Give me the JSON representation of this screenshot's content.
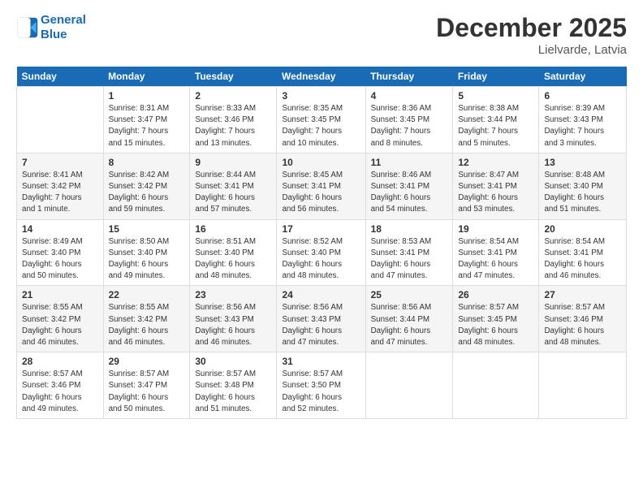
{
  "logo": {
    "line1": "General",
    "line2": "Blue"
  },
  "title": "December 2025",
  "location": "Lielvarde, Latvia",
  "weekdays": [
    "Sunday",
    "Monday",
    "Tuesday",
    "Wednesday",
    "Thursday",
    "Friday",
    "Saturday"
  ],
  "weeks": [
    [
      {
        "day": "",
        "text": ""
      },
      {
        "day": "1",
        "text": "Sunrise: 8:31 AM\nSunset: 3:47 PM\nDaylight: 7 hours\nand 15 minutes."
      },
      {
        "day": "2",
        "text": "Sunrise: 8:33 AM\nSunset: 3:46 PM\nDaylight: 7 hours\nand 13 minutes."
      },
      {
        "day": "3",
        "text": "Sunrise: 8:35 AM\nSunset: 3:45 PM\nDaylight: 7 hours\nand 10 minutes."
      },
      {
        "day": "4",
        "text": "Sunrise: 8:36 AM\nSunset: 3:45 PM\nDaylight: 7 hours\nand 8 minutes."
      },
      {
        "day": "5",
        "text": "Sunrise: 8:38 AM\nSunset: 3:44 PM\nDaylight: 7 hours\nand 5 minutes."
      },
      {
        "day": "6",
        "text": "Sunrise: 8:39 AM\nSunset: 3:43 PM\nDaylight: 7 hours\nand 3 minutes."
      }
    ],
    [
      {
        "day": "7",
        "text": "Sunrise: 8:41 AM\nSunset: 3:42 PM\nDaylight: 7 hours\nand 1 minute."
      },
      {
        "day": "8",
        "text": "Sunrise: 8:42 AM\nSunset: 3:42 PM\nDaylight: 6 hours\nand 59 minutes."
      },
      {
        "day": "9",
        "text": "Sunrise: 8:44 AM\nSunset: 3:41 PM\nDaylight: 6 hours\nand 57 minutes."
      },
      {
        "day": "10",
        "text": "Sunrise: 8:45 AM\nSunset: 3:41 PM\nDaylight: 6 hours\nand 56 minutes."
      },
      {
        "day": "11",
        "text": "Sunrise: 8:46 AM\nSunset: 3:41 PM\nDaylight: 6 hours\nand 54 minutes."
      },
      {
        "day": "12",
        "text": "Sunrise: 8:47 AM\nSunset: 3:41 PM\nDaylight: 6 hours\nand 53 minutes."
      },
      {
        "day": "13",
        "text": "Sunrise: 8:48 AM\nSunset: 3:40 PM\nDaylight: 6 hours\nand 51 minutes."
      }
    ],
    [
      {
        "day": "14",
        "text": "Sunrise: 8:49 AM\nSunset: 3:40 PM\nDaylight: 6 hours\nand 50 minutes."
      },
      {
        "day": "15",
        "text": "Sunrise: 8:50 AM\nSunset: 3:40 PM\nDaylight: 6 hours\nand 49 minutes."
      },
      {
        "day": "16",
        "text": "Sunrise: 8:51 AM\nSunset: 3:40 PM\nDaylight: 6 hours\nand 48 minutes."
      },
      {
        "day": "17",
        "text": "Sunrise: 8:52 AM\nSunset: 3:40 PM\nDaylight: 6 hours\nand 48 minutes."
      },
      {
        "day": "18",
        "text": "Sunrise: 8:53 AM\nSunset: 3:41 PM\nDaylight: 6 hours\nand 47 minutes."
      },
      {
        "day": "19",
        "text": "Sunrise: 8:54 AM\nSunset: 3:41 PM\nDaylight: 6 hours\nand 47 minutes."
      },
      {
        "day": "20",
        "text": "Sunrise: 8:54 AM\nSunset: 3:41 PM\nDaylight: 6 hours\nand 46 minutes."
      }
    ],
    [
      {
        "day": "21",
        "text": "Sunrise: 8:55 AM\nSunset: 3:42 PM\nDaylight: 6 hours\nand 46 minutes."
      },
      {
        "day": "22",
        "text": "Sunrise: 8:55 AM\nSunset: 3:42 PM\nDaylight: 6 hours\nand 46 minutes."
      },
      {
        "day": "23",
        "text": "Sunrise: 8:56 AM\nSunset: 3:43 PM\nDaylight: 6 hours\nand 46 minutes."
      },
      {
        "day": "24",
        "text": "Sunrise: 8:56 AM\nSunset: 3:43 PM\nDaylight: 6 hours\nand 47 minutes."
      },
      {
        "day": "25",
        "text": "Sunrise: 8:56 AM\nSunset: 3:44 PM\nDaylight: 6 hours\nand 47 minutes."
      },
      {
        "day": "26",
        "text": "Sunrise: 8:57 AM\nSunset: 3:45 PM\nDaylight: 6 hours\nand 48 minutes."
      },
      {
        "day": "27",
        "text": "Sunrise: 8:57 AM\nSunset: 3:46 PM\nDaylight: 6 hours\nand 48 minutes."
      }
    ],
    [
      {
        "day": "28",
        "text": "Sunrise: 8:57 AM\nSunset: 3:46 PM\nDaylight: 6 hours\nand 49 minutes."
      },
      {
        "day": "29",
        "text": "Sunrise: 8:57 AM\nSunset: 3:47 PM\nDaylight: 6 hours\nand 50 minutes."
      },
      {
        "day": "30",
        "text": "Sunrise: 8:57 AM\nSunset: 3:48 PM\nDaylight: 6 hours\nand 51 minutes."
      },
      {
        "day": "31",
        "text": "Sunrise: 8:57 AM\nSunset: 3:50 PM\nDaylight: 6 hours\nand 52 minutes."
      },
      {
        "day": "",
        "text": ""
      },
      {
        "day": "",
        "text": ""
      },
      {
        "day": "",
        "text": ""
      }
    ]
  ]
}
